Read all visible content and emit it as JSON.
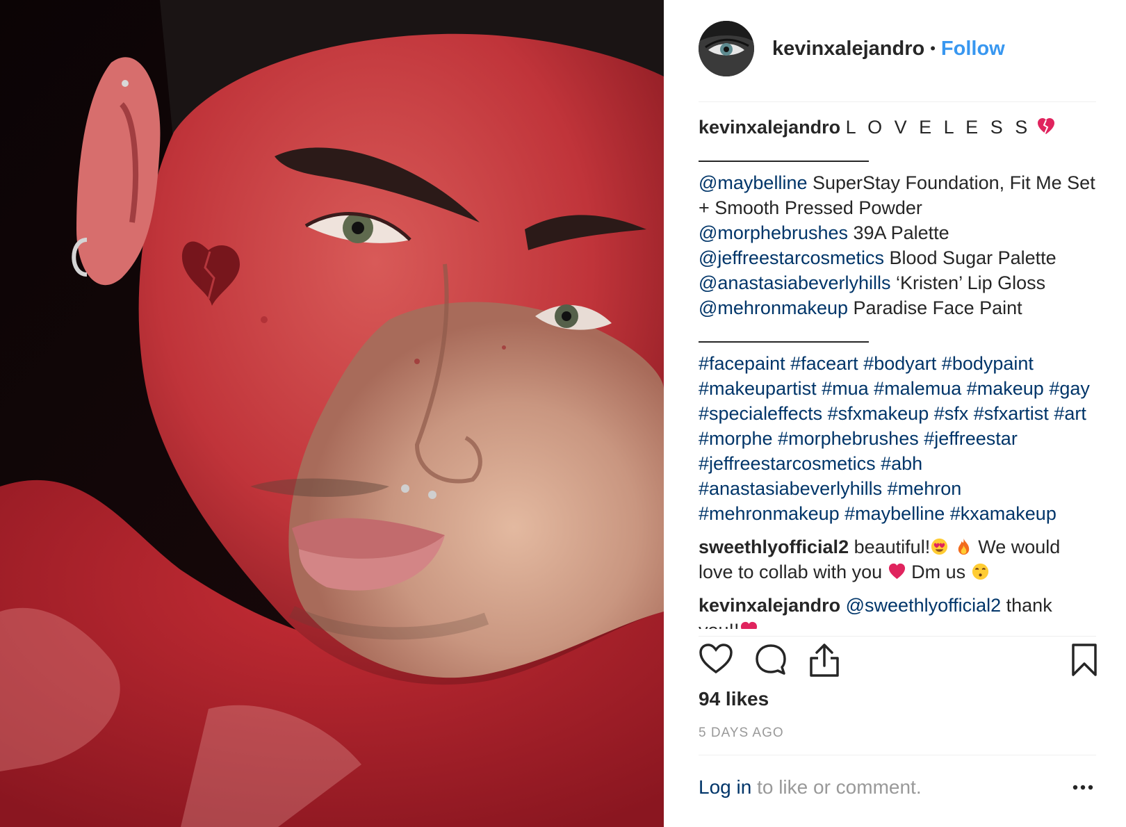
{
  "photo": {
    "subject": "face-paint-portrait"
  },
  "header": {
    "username": "kevinxalejandro",
    "separator": "•",
    "follow_label": "Follow"
  },
  "caption": {
    "username": "kevinxalejandro",
    "title": "L O V E L E S S",
    "products": [
      {
        "handle": "@maybelline",
        "text": " SuperStay Foundation, Fit Me Set + Smooth Pressed Powder"
      },
      {
        "handle": "@morphebrushes",
        "text": " 39A Palette"
      },
      {
        "handle": "@jeffreestarcosmetics",
        "text": " Blood Sugar Palette"
      },
      {
        "handle": "@anastasiabeverlyhills",
        "text": " ‘Kristen’ Lip Gloss"
      },
      {
        "handle": "@mehronmakeup",
        "text": " Paradise Face Paint"
      }
    ],
    "hashtags": [
      "#facepaint",
      "#faceart",
      "#bodyart",
      "#bodypaint",
      "#makeupartist",
      "#mua",
      "#malemua",
      "#makeup",
      "#gay",
      "#specialeffects",
      "#sfxmakeup",
      "#sfx",
      "#sfxartist",
      "#art",
      "#morphe",
      "#morphebrushes",
      "#jeffreestar",
      "#jeffreestarcosmetics",
      "#abh",
      "#anastasiabeverlyhills",
      "#mehron",
      "#mehronmakeup",
      "#maybelline",
      "#kxamakeup"
    ]
  },
  "comments": [
    {
      "username": "sweethlyofficial2",
      "text_a": "beautiful!",
      "text_b": " We would love to collab with you ",
      "text_c": "  Dm us "
    },
    {
      "username": "kevinxalejandro",
      "mention": "@sweethlyofficial2",
      "text_a": " thank you!!"
    }
  ],
  "actions": {
    "like": "heart-icon",
    "comment": "comment-icon",
    "share": "share-icon",
    "save": "bookmark-icon"
  },
  "likes": "94 likes",
  "timestamp": "5 DAYS AGO",
  "login": {
    "link": "Log in",
    "rest": " to like or comment."
  },
  "more_label": "•••",
  "colors": {
    "link": "#003569",
    "follow": "#3897f0",
    "text": "#262626",
    "muted": "#999999",
    "paint": "#b3272e"
  }
}
